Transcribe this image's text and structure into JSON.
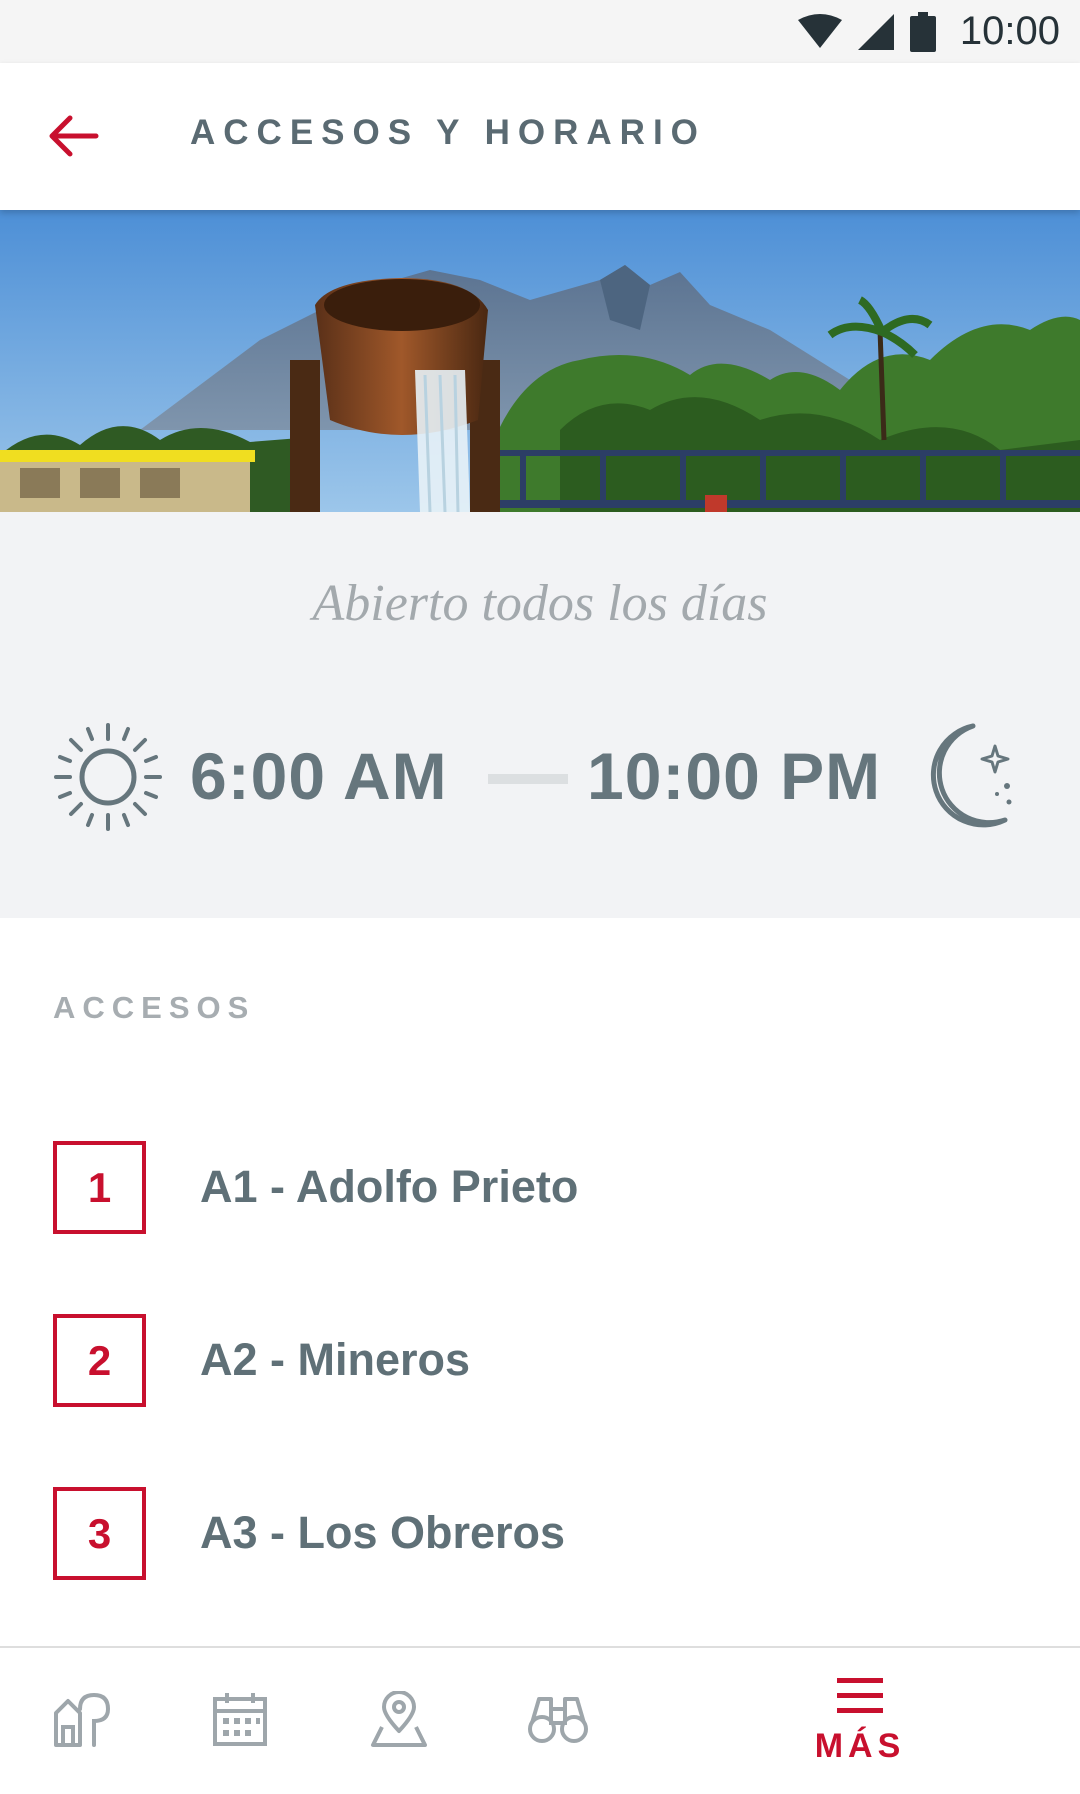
{
  "status_bar": {
    "time": "10:00",
    "icons": [
      "wifi-icon",
      "signal-icon",
      "battery-icon"
    ]
  },
  "app_bar": {
    "title": "ACCESOS Y HORARIO",
    "back_icon": "arrow-left-icon"
  },
  "hero": {
    "image": "park-fountain-mountain-photo"
  },
  "hours": {
    "open_label": "Abierto todos los días",
    "open_time": "6:00 AM",
    "close_time": "10:00 PM",
    "open_icon": "sun-icon",
    "close_icon": "moon-icon"
  },
  "accesses": {
    "heading": "ACCESOS",
    "items": [
      {
        "number": "1",
        "label": "A1 - Adolfo Prieto"
      },
      {
        "number": "2",
        "label": "A2 - Mineros"
      },
      {
        "number": "3",
        "label": "A3 - Los Obreros"
      }
    ]
  },
  "bottom_nav": {
    "items": [
      {
        "icon": "map-signpost-icon",
        "active": false
      },
      {
        "icon": "calendar-icon",
        "active": false
      },
      {
        "icon": "location-pin-icon",
        "active": false
      },
      {
        "icon": "binoculars-icon",
        "active": false
      },
      {
        "icon": "menu-icon",
        "label": "MÁS",
        "active": true
      }
    ]
  },
  "colors": {
    "accent": "#c8102e",
    "text_primary": "#5f7077",
    "panel_bg": "#f2f3f5",
    "nav_icon": "#9ea6ab"
  }
}
